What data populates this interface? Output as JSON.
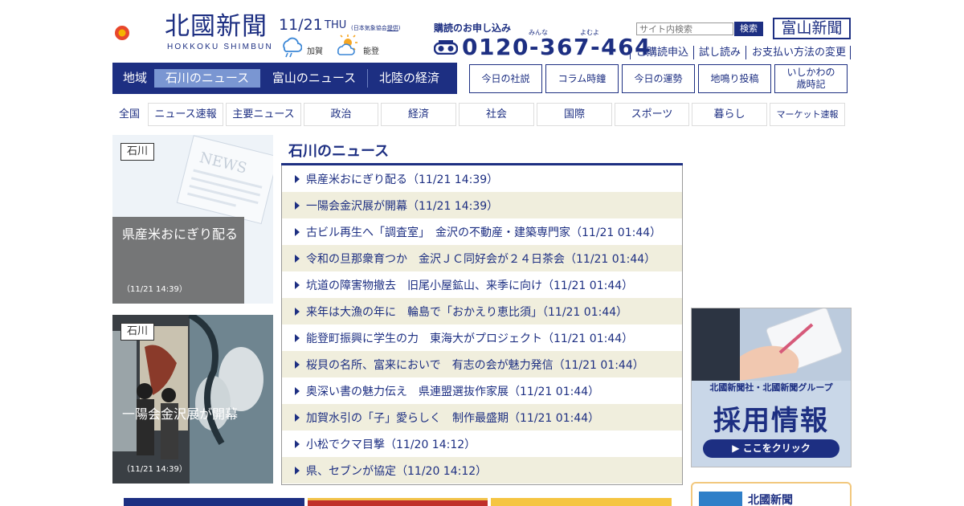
{
  "header": {
    "logo_title": "北國新聞",
    "logo_sub": "HOKKOKU SHIMBUN",
    "date_day": "11/21",
    "date_week": "THU",
    "weather_credit_prefix": "(日本気象協会",
    "weather_credit_link": "提供",
    "weather_credit_suffix": ")",
    "weather": [
      {
        "area": "加賀",
        "icon": "rain-after-cloudy-icon"
      },
      {
        "area": "能登",
        "icon": "sun-cloud-icon"
      }
    ],
    "subscribe_label": "購読のお申し込み",
    "subscribe_ruby": [
      "みんな",
      "よむよ"
    ],
    "phone": "0120-367-464",
    "search_placeholder": "サイト内検索",
    "search_button": "検索",
    "toyama_button": "富山新聞",
    "top_links": [
      "ご購読申込",
      "試し読み",
      "お支払い方法の変更"
    ]
  },
  "region_nav": {
    "label": "地域",
    "tabs": [
      "石川のニュース",
      "富山のニュース",
      "北陸の経済"
    ],
    "active": "石川のニュース"
  },
  "feature_buttons": [
    "今日の社説",
    "コラム時鐘",
    "今日の運勢",
    "地鳴り投稿",
    "いしかわの\n歳時記"
  ],
  "category_nav": {
    "all": "全国",
    "items": [
      "ニュース速報",
      "主要ニュース",
      "政治",
      "経済",
      "社会",
      "国際",
      "スポーツ",
      "暮らし",
      "マーケット速報"
    ]
  },
  "cards": [
    {
      "tag": "石川",
      "title": "県産米おにぎり配る",
      "time": "（11/21 14:39）"
    },
    {
      "tag": "石川",
      "title": "一陽会金沢展が開幕",
      "time": "（11/21 14:39）"
    }
  ],
  "news": {
    "heading": "石川のニュース",
    "items": [
      "県産米おにぎり配る（11/21 14:39）",
      "一陽会金沢展が開幕（11/21 14:39）",
      "古ビル再生へ「調査室」　金沢の不動産・建築専門家（11/21 01:44）",
      "令和の旦那衆育つか　金沢ＪＣ同好会が２４日茶会（11/21 01:44）",
      "坑道の障害物撤去　旧尾小屋鉱山、来季に向け（11/21 01:44）",
      "来年は大漁の年に　輪島で「おかえり恵比須」（11/21 01:44）",
      "能登町振興に学生の力　東海大がプロジェクト（11/21 01:44）",
      "桜貝の名所、富来においで　有志の会が魅力発信（11/21 01:44）",
      "奥深い書の魅力伝え　県連盟選抜作家展（11/21 01:44）",
      "加賀水引の「子」愛らしく　制作最盛期（11/21 01:44）",
      "小松でクマ目撃（11/20 14:12）",
      "県、セブンが協定（11/20 14:12）"
    ]
  },
  "ads": {
    "recruit_company": "北國新聞社・北國新聞グループ",
    "recruit_title": "採用情報",
    "recruit_click": "▶ ここをクリック",
    "bottom_box_label": "北國新聞"
  },
  "colors": {
    "brand": "#1d2f82",
    "active_tab": "#7a96d2",
    "row_alt": "#f0eedd"
  }
}
